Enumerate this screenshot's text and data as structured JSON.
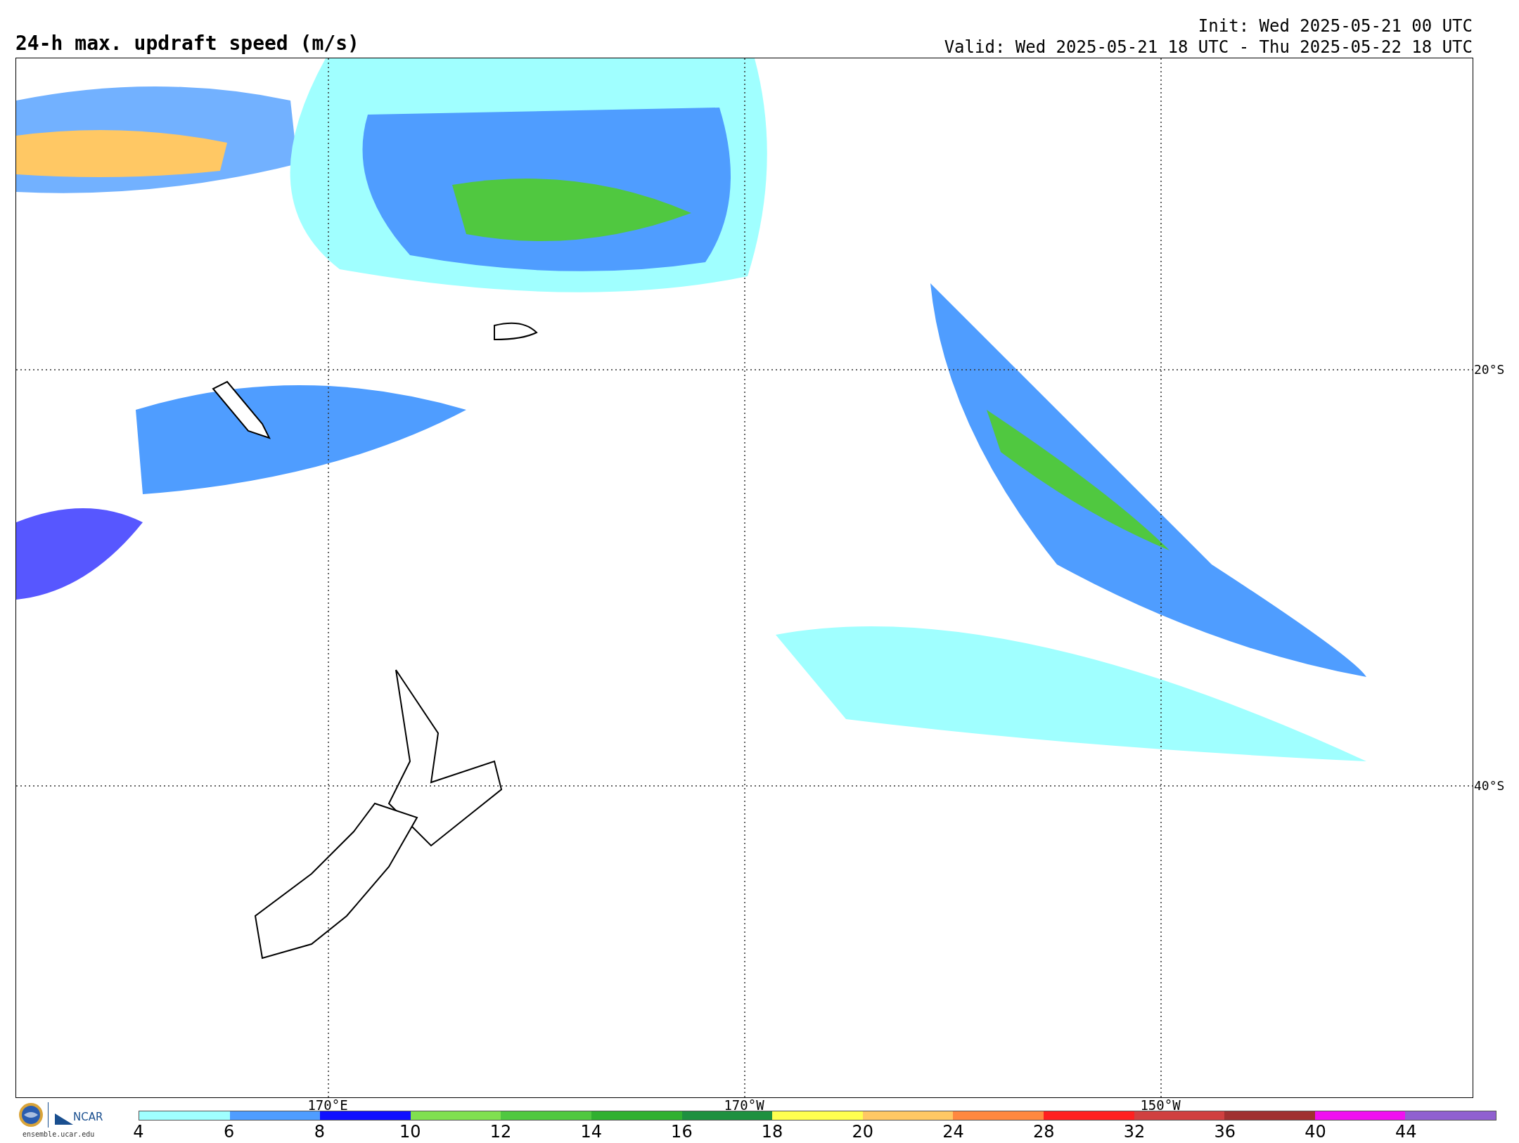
{
  "title": "24-h max. updraft speed (m/s)",
  "init": "Init: Wed 2025-05-21 00 UTC",
  "valid": "Valid: Wed 2025-05-21 18 UTC - Thu 2025-05-22 18 UTC",
  "map": {
    "lat_labels": [
      "20°S",
      "40°S"
    ],
    "lon_labels": [
      "170°E",
      "170°W",
      "150°W"
    ]
  },
  "logos": {
    "ncar": "NCAR",
    "url": "ensemble.ucar.edu"
  },
  "colorbar": [
    {
      "label": "4",
      "color": "#a0ffff"
    },
    {
      "label": "6",
      "color": "#4f9dff"
    },
    {
      "label": "8",
      "color": "#1010ff"
    },
    {
      "label": "10",
      "color": "#80e050"
    },
    {
      "label": "12",
      "color": "#50c840"
    },
    {
      "label": "14",
      "color": "#30b030"
    },
    {
      "label": "16",
      "color": "#1e9040"
    },
    {
      "label": "18",
      "color": "#ffff50"
    },
    {
      "label": "20",
      "color": "#ffc864"
    },
    {
      "label": "24",
      "color": "#ff8840"
    },
    {
      "label": "28",
      "color": "#ff2020"
    },
    {
      "label": "32",
      "color": "#d04040"
    },
    {
      "label": "36",
      "color": "#a03030"
    },
    {
      "label": "40",
      "color": "#f010f0"
    },
    {
      "label": "44",
      "color": "#9060d0"
    }
  ]
}
